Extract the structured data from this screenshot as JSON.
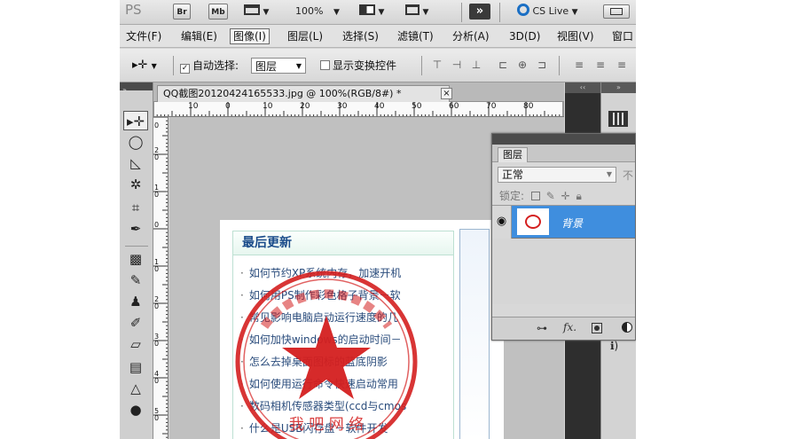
{
  "topbar": {
    "ps_logo": "PS",
    "bridge": "Br",
    "minibridge": "Mb",
    "zoom": "100%",
    "cs_live": "CS Live"
  },
  "menu": {
    "items": [
      "文件(F)",
      "编辑(E)",
      "图像(I)",
      "图层(L)",
      "选择(S)",
      "滤镜(T)",
      "分析(A)",
      "3D(D)",
      "视图(V)",
      "窗口"
    ]
  },
  "options": {
    "auto_select_label": "自动选择:",
    "auto_select_value": "图层",
    "show_transform_label": "显示变换控件"
  },
  "document": {
    "tab_title": "QQ截图20120424165533.jpg @ 100%(RGB/8#) *",
    "close_glyph": "×",
    "ruler_h": [
      "10",
      "0",
      "10",
      "20",
      "30",
      "40",
      "50",
      "60",
      "70",
      "80"
    ],
    "ruler_v": [
      "0",
      "2\n0",
      "1\n0",
      "0",
      "1\n0",
      "2\n0",
      "3\n0",
      "4\n0",
      "5\n0"
    ]
  },
  "news": {
    "title": "最后更新",
    "items": [
      "如何节约XP系统内存，加速开机",
      "如何用PS制作彩色格子背景－软",
      "常见影响电脑启动运行速度的几",
      "如何加快windows的启动时间－",
      "怎么去掉桌面图标的蓝底阴影",
      "如何使用运行命令快速启动常用",
      "数码相机传感器类型(ccd与cmos",
      "什么是USB闪存盘－软件开发"
    ]
  },
  "stamp": {
    "bottom_text": "我 吧 网 络"
  },
  "layers": {
    "tab": "图层",
    "blend_mode": "正常",
    "opacity_label": "不",
    "lock_label": "锁定:",
    "layer_name": "背景"
  },
  "colors": {
    "accent": "#3f8ede",
    "stamp_red": "#d41f1f",
    "news_title": "#1a4b8a"
  }
}
